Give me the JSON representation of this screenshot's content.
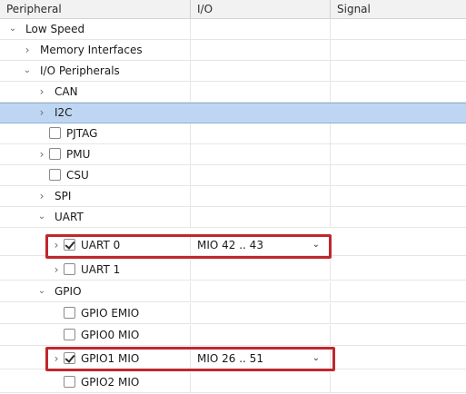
{
  "header": {
    "col_peripheral": "Peripheral",
    "col_io": "I/O",
    "col_signal": "Signal"
  },
  "tree": {
    "low_speed": "Low Speed",
    "memory_interfaces": "Memory Interfaces",
    "io_peripherals": "I/O Peripherals",
    "can": "CAN",
    "i2c": "I2C",
    "pjtag": "PJTAG",
    "pmu": "PMU",
    "csu": "CSU",
    "spi": "SPI",
    "uart": "UART",
    "uart0": "UART 0",
    "uart0_io": "MIO 42 .. 43",
    "uart1": "UART 1",
    "gpio": "GPIO",
    "gpio_emio": "GPIO EMIO",
    "gpio0_mio": "GPIO0 MIO",
    "gpio1_mio": "GPIO1 MIO",
    "gpio1_io": "MIO 26 .. 51",
    "gpio2_mio": "GPIO2 MIO"
  },
  "colors": {
    "selection": "#bfd6f2",
    "highlight": "#c0272d"
  }
}
